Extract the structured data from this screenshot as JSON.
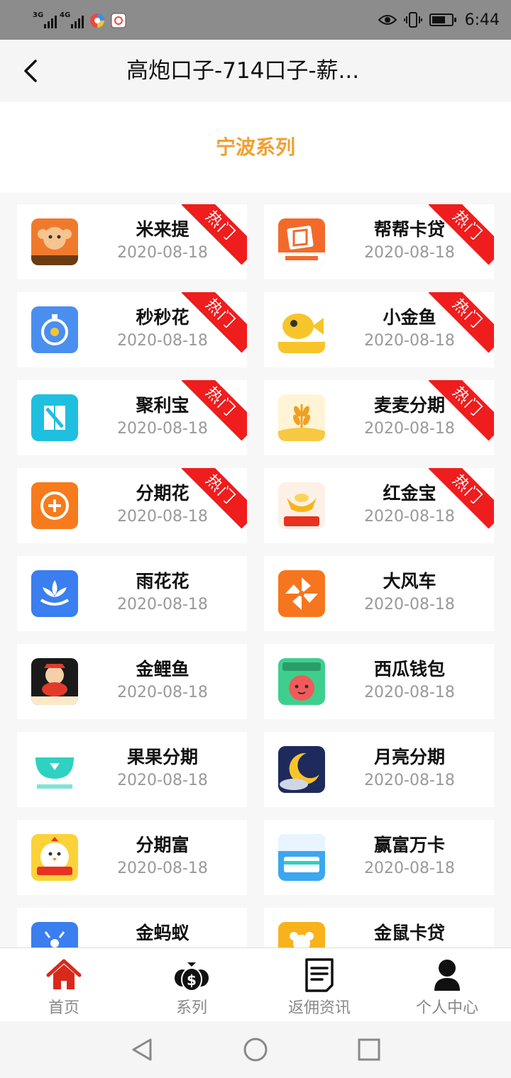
{
  "status_bar": {
    "signal1_label": "3G",
    "signal2_label": "4G",
    "time": "6:44"
  },
  "header": {
    "title": "高炮口子-714口子-薪...",
    "back_icon": "chevron-left-icon"
  },
  "section": {
    "title": "宁波系列"
  },
  "hot_label": "热门",
  "apps": [
    {
      "name": "米来提",
      "date": "2020-08-18",
      "hot": true
    },
    {
      "name": "帮帮卡贷",
      "date": "2020-08-18",
      "hot": true
    },
    {
      "name": "秒秒花",
      "date": "2020-08-18",
      "hot": true
    },
    {
      "name": "小金鱼",
      "date": "2020-08-18",
      "hot": true
    },
    {
      "name": "聚利宝",
      "date": "2020-08-18",
      "hot": true
    },
    {
      "name": "麦麦分期",
      "date": "2020-08-18",
      "hot": true
    },
    {
      "name": "分期花",
      "date": "2020-08-18",
      "hot": true
    },
    {
      "name": "红金宝",
      "date": "2020-08-18",
      "hot": true
    },
    {
      "name": "雨花花",
      "date": "2020-08-18",
      "hot": false
    },
    {
      "name": "大风车",
      "date": "2020-08-18",
      "hot": false
    },
    {
      "name": "金鲤鱼",
      "date": "2020-08-18",
      "hot": false
    },
    {
      "name": "西瓜钱包",
      "date": "2020-08-18",
      "hot": false
    },
    {
      "name": "果果分期",
      "date": "2020-08-18",
      "hot": false
    },
    {
      "name": "月亮分期",
      "date": "2020-08-18",
      "hot": false
    },
    {
      "name": "分期富",
      "date": "2020-08-18",
      "hot": false
    },
    {
      "name": "赢富万卡",
      "date": "2020-08-18",
      "hot": false
    },
    {
      "name": "金蚂蚁",
      "date": "",
      "hot": false
    },
    {
      "name": "金鼠卡贷",
      "date": "",
      "hot": false
    }
  ],
  "bottom_nav": [
    {
      "label": "首页",
      "icon": "home-icon",
      "active": true
    },
    {
      "label": "系列",
      "icon": "money-bags-icon",
      "active": false
    },
    {
      "label": "返佣资讯",
      "icon": "document-icon",
      "active": false
    },
    {
      "label": "个人中心",
      "icon": "person-icon",
      "active": false
    }
  ],
  "colors": {
    "accent": "#f0a030",
    "hot_ribbon": "#ef1d1d",
    "active_nav": "#d9291c",
    "date_text": "#999999"
  }
}
